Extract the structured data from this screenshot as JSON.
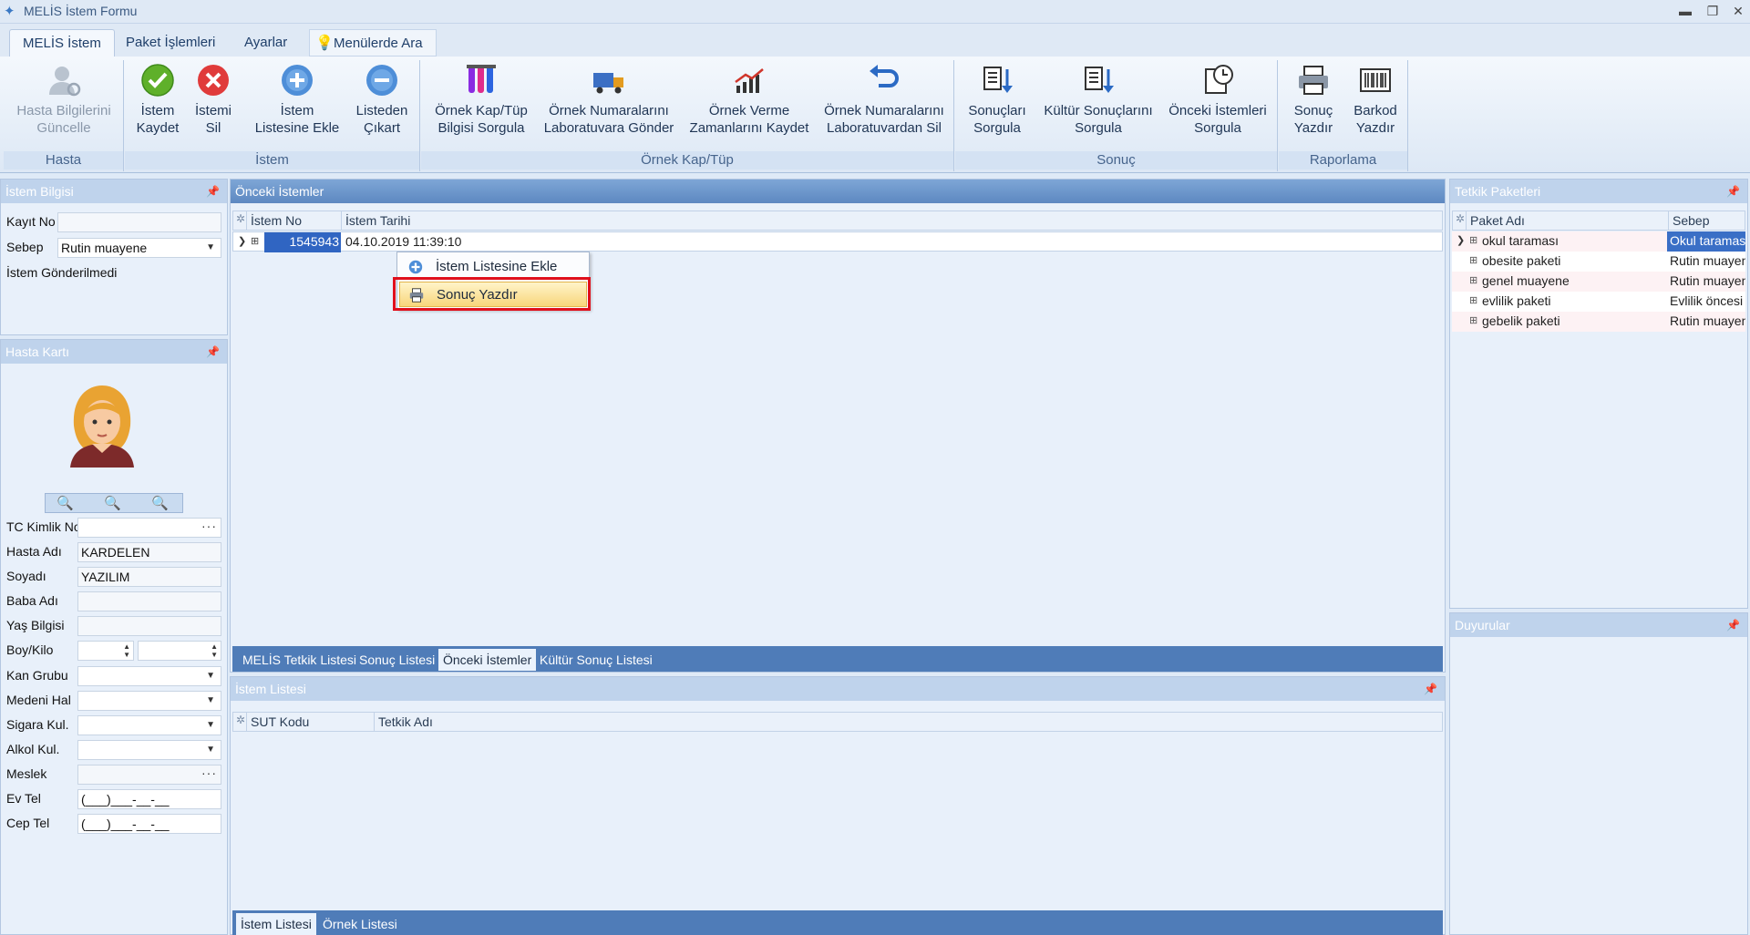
{
  "window": {
    "title": "MELİS İstem Formu",
    "minimize": "▬",
    "restore": "❐",
    "close": "✕"
  },
  "tabs": [
    {
      "label": "MELİS İstem",
      "active": true
    },
    {
      "label": "Paket İşlemleri"
    },
    {
      "label": "Ayarlar"
    }
  ],
  "menu_search": "Menülerde Ara",
  "ribbon": {
    "groups": [
      {
        "label": "Hasta",
        "buttons": [
          {
            "line1": "Hasta Bilgilerini",
            "line2": "Güncelle",
            "icon": "user-refresh-icon",
            "disabled": true
          }
        ]
      },
      {
        "label": "İstem",
        "buttons": [
          {
            "line1": "İstem",
            "line2": "Kaydet",
            "icon": "check-icon"
          },
          {
            "line1": "İstemi",
            "line2": "Sil",
            "icon": "delete-icon"
          },
          {
            "line1": "İstem",
            "line2": "Listesine Ekle",
            "icon": "add-icon"
          },
          {
            "line1": "Listeden",
            "line2": "Çıkart",
            "icon": "remove-icon"
          }
        ]
      },
      {
        "label": "Örnek Kap/Tüp",
        "buttons": [
          {
            "line1": "Örnek Kap/Tüp",
            "line2": "Bilgisi Sorgula",
            "icon": "test-tubes-icon"
          },
          {
            "line1": "Örnek Numaralarını",
            "line2": "Laboratuvara Gönder",
            "icon": "truck-icon"
          },
          {
            "line1": "Örnek Verme",
            "line2": "Zamanlarını Kaydet",
            "icon": "chart-icon"
          },
          {
            "line1": "Örnek Numaralarını",
            "line2": "Laboratuvardan Sil",
            "icon": "undo-icon"
          }
        ]
      },
      {
        "label": "Sonuç",
        "buttons": [
          {
            "line1": "Sonuçları",
            "line2": "Sorgula",
            "icon": "doc-down-icon"
          },
          {
            "line1": "Kültür Sonuçlarını",
            "line2": "Sorgula",
            "icon": "doc-down-icon"
          },
          {
            "line1": "Önceki İstemleri",
            "line2": "Sorgula",
            "icon": "clock-icon"
          }
        ]
      },
      {
        "label": "Raporlama",
        "buttons": [
          {
            "line1": "Sonuç",
            "line2": "Yazdır",
            "icon": "printer-icon"
          },
          {
            "line1": "Barkod",
            "line2": "Yazdır",
            "icon": "barcode-icon"
          }
        ]
      }
    ]
  },
  "istem_bilgisi": {
    "title": "İstem Bilgisi",
    "kayit_no_label": "Kayıt No",
    "kayit_no": "",
    "sebep_label": "Sebep",
    "sebep": "Rutin muayene",
    "status": "İstem Gönderilmedi"
  },
  "hasta_karti": {
    "title": "Hasta Kartı",
    "fields": [
      {
        "label": "TC Kimlik No",
        "value": ""
      },
      {
        "label": "Hasta Adı",
        "value": "KARDELEN"
      },
      {
        "label": "Soyadı",
        "value": "YAZILIM"
      },
      {
        "label": "Baba Adı",
        "value": ""
      },
      {
        "label": "Yaş Bilgisi",
        "value": ""
      },
      {
        "label": "Boy/Kilo",
        "value": ""
      },
      {
        "label": "Kan Grubu",
        "value": ""
      },
      {
        "label": "Medeni Hal",
        "value": ""
      },
      {
        "label": "Sigara Kul.",
        "value": ""
      },
      {
        "label": "Alkol Kul.",
        "value": ""
      },
      {
        "label": "Meslek",
        "value": ""
      },
      {
        "label": "Ev Tel",
        "value": "(___)___-__-__"
      },
      {
        "label": "Cep Tel",
        "value": "(___)___-__-__"
      }
    ]
  },
  "onceki_istemler": {
    "title": "Önceki İstemler",
    "columns": [
      "İstem No",
      "İstem Tarihi"
    ],
    "rows": [
      {
        "istem_no": "1545943",
        "tarih": "04.10.2019 11:39:10"
      }
    ]
  },
  "context_menu": {
    "items": [
      {
        "label": "İstem Listesine Ekle",
        "icon": "add-icon"
      },
      {
        "label": "Sonuç Yazdır",
        "icon": "printer-icon",
        "highlighted": true
      }
    ]
  },
  "middle_tabs": [
    {
      "label": "MELİS Tetkik Listesi"
    },
    {
      "label": "Sonuç Listesi"
    },
    {
      "label": "Önceki İstemler",
      "active": true
    },
    {
      "label": "Kültür Sonuç Listesi"
    }
  ],
  "istem_listesi": {
    "title": "İstem Listesi",
    "columns": [
      "SUT Kodu",
      "Tetkik Adı"
    ]
  },
  "bottom_tabs": [
    {
      "label": "İstem Listesi",
      "active": true
    },
    {
      "label": "Örnek Listesi"
    }
  ],
  "tetkik_paketleri": {
    "title": "Tetkik Paketleri",
    "columns": [
      "Paket Adı",
      "Sebep"
    ],
    "rows": [
      {
        "name": "okul taraması",
        "sebep": "Okul taraması"
      },
      {
        "name": "obesite paketi",
        "sebep": "Rutin muayene"
      },
      {
        "name": "genel muayene",
        "sebep": "Rutin muayene"
      },
      {
        "name": "evlilik paketi",
        "sebep": "Evlilik öncesi tarama"
      },
      {
        "name": "gebelik paketi",
        "sebep": "Rutin muayene"
      }
    ]
  },
  "duyurular": {
    "title": "Duyurular"
  }
}
